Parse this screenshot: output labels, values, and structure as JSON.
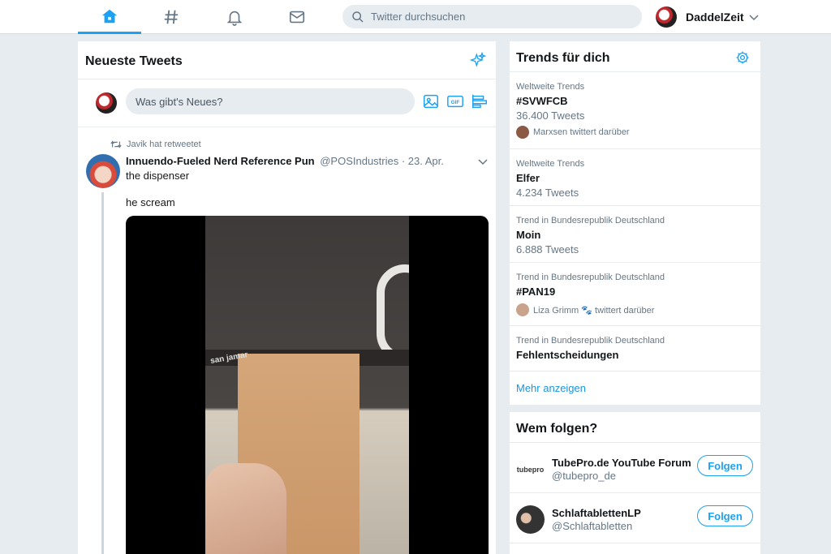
{
  "nav": {
    "items": [
      {
        "icon": "home-icon",
        "active": true
      },
      {
        "icon": "hashtag-icon",
        "active": false
      },
      {
        "icon": "bell-icon",
        "active": false
      },
      {
        "icon": "mail-icon",
        "active": false
      }
    ],
    "search_placeholder": "Twitter durchsuchen",
    "account_name": "DaddelZeit",
    "accent": "#1da1f2"
  },
  "timeline": {
    "title": "Neueste Tweets",
    "composer_placeholder": "Was gibt's Neues?",
    "tweet": {
      "retweeted_by": "Javik hat retweetet",
      "author": "Innuendo-Fueled Nerd Reference Pun",
      "handle": "@POSIndustries · 23. Apr.",
      "text1": "the dispenser",
      "text2": "he scream",
      "media_brand": "san jamar"
    }
  },
  "trends": {
    "title": "Trends für dich",
    "items": [
      {
        "category": "Weltweite Trends",
        "name": "#SVWFCB",
        "count": "36.400 Tweets",
        "who": "Marxsen twittert darüber"
      },
      {
        "category": "Weltweite Trends",
        "name": "Elfer",
        "count": "4.234 Tweets"
      },
      {
        "category": "Trend in Bundesrepublik Deutschland",
        "name": "Moin",
        "count": "6.888 Tweets"
      },
      {
        "category": "Trend in Bundesrepublik Deutschland",
        "name": "#PAN19",
        "who": "Liza Grimm 🐾 twittert darüber"
      },
      {
        "category": "Trend in Bundesrepublik Deutschland",
        "name": "Fehlentscheidungen"
      }
    ],
    "more": "Mehr anzeigen"
  },
  "who_to_follow": {
    "title": "Wem folgen?",
    "items": [
      {
        "name": "TubePro.de YouTube Forum",
        "handle": "@tubepro_de",
        "avatar_text": "tubepro",
        "button": "Folgen"
      },
      {
        "name": "SchlaftablettenLP",
        "handle": "@Schlaftabletten",
        "button": "Folgen"
      }
    ]
  }
}
